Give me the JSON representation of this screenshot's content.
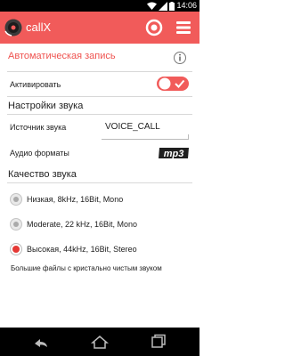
{
  "status_bar": {
    "time": "14:06"
  },
  "app_bar": {
    "title": "callX",
    "logo_icon": "callx-logo-icon",
    "record_icon": "record-icon",
    "menu_icon": "menu-icon",
    "color": "#f15b5a"
  },
  "auto_record": {
    "header": "Автоматическая запись",
    "info_icon": "info-icon",
    "activate_label": "Активировать",
    "activate_enabled": true
  },
  "sound_settings": {
    "title": "Настройки звука",
    "source_label": "Источник звука",
    "source_value": "VOICE_CALL",
    "format_label": "Аудио форматы",
    "format_icon": "mp3-icon"
  },
  "sound_quality": {
    "title": "Качество звука",
    "options": [
      {
        "label": "Низкая, 8kHz, 16Bit, Mono",
        "selected": false
      },
      {
        "label": "Moderate, 22 kHz, 16Bit, Mono",
        "selected": false
      },
      {
        "label": "Высокая, 44kHz, 16Bit, Stereo",
        "selected": true
      }
    ],
    "note": "Большие файлы с кристально чистым звуком"
  },
  "nav_bar": {
    "back_icon": "back-icon",
    "home_icon": "home-icon",
    "recents_icon": "recents-icon"
  }
}
